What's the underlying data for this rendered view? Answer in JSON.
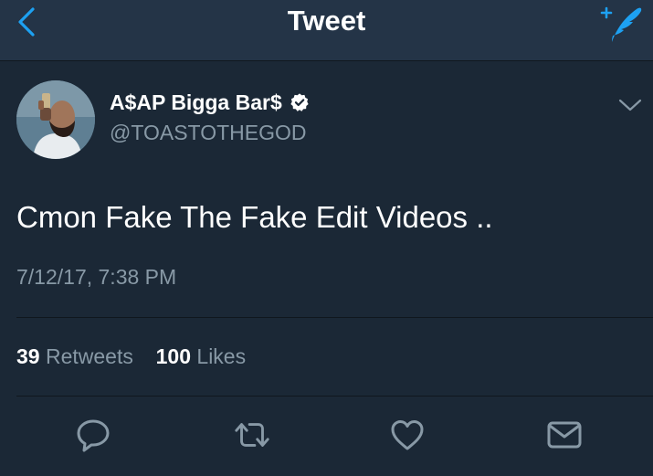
{
  "navbar": {
    "title": "Tweet",
    "back_icon": "chevron-left-icon",
    "compose_icon": "compose-tweet-icon"
  },
  "tweet": {
    "display_name": "A$AP Bigga Bar$",
    "verified": true,
    "handle": "@TOASTOTHEGOD",
    "text": "Cmon Fake The Fake Edit Videos ..",
    "timestamp": "7/12/17, 7:38 PM",
    "stats": {
      "retweets_count": "39",
      "retweets_label": "Retweets",
      "likes_count": "100",
      "likes_label": "Likes"
    },
    "actions": [
      "reply-icon",
      "retweet-icon",
      "like-icon",
      "direct-message-icon"
    ]
  },
  "colors": {
    "background": "#1b2836",
    "navbar": "#243447",
    "accent": "#1da1f2",
    "secondary_text": "#8899a6",
    "icon": "#8899a6"
  }
}
